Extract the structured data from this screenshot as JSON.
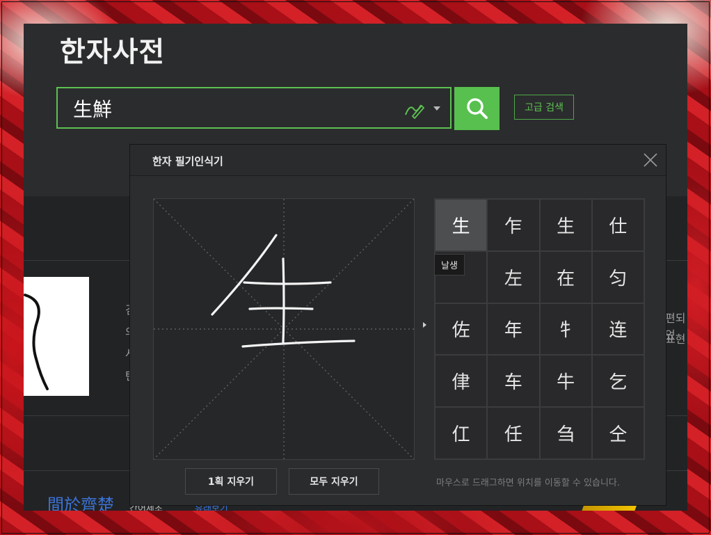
{
  "header": {
    "title": "한자사전"
  },
  "search": {
    "value": "生鮮",
    "advanced_label": "고급 검색"
  },
  "page_bits": {
    "left_peek": [
      "검",
      "의",
      "사",
      "탄"
    ],
    "right_peek": [
      "편되었",
      "표현"
    ],
    "bottom_title": "間於齊楚",
    "bottom_sub": "간어제초",
    "bottom_link": "유래보기"
  },
  "handwriting": {
    "title": "한자 필기인식기",
    "candidates": [
      "生",
      "乍",
      "生",
      "仕",
      "",
      "左",
      "在",
      "匀",
      "佐",
      "年",
      "牜",
      "连",
      "侓",
      "车",
      "牛",
      "乞",
      "仜",
      "任",
      "刍",
      "仝"
    ],
    "tooltip": "날생",
    "clear_one_label": "1획 지우기",
    "clear_all_label": "모두 지우기",
    "hint": "마우스로 드래그하면 위치를 이동할 수 있습니다."
  },
  "colors": {
    "accent": "#5cc150",
    "link": "#3b73d6",
    "panel": "#2b2c2e"
  }
}
